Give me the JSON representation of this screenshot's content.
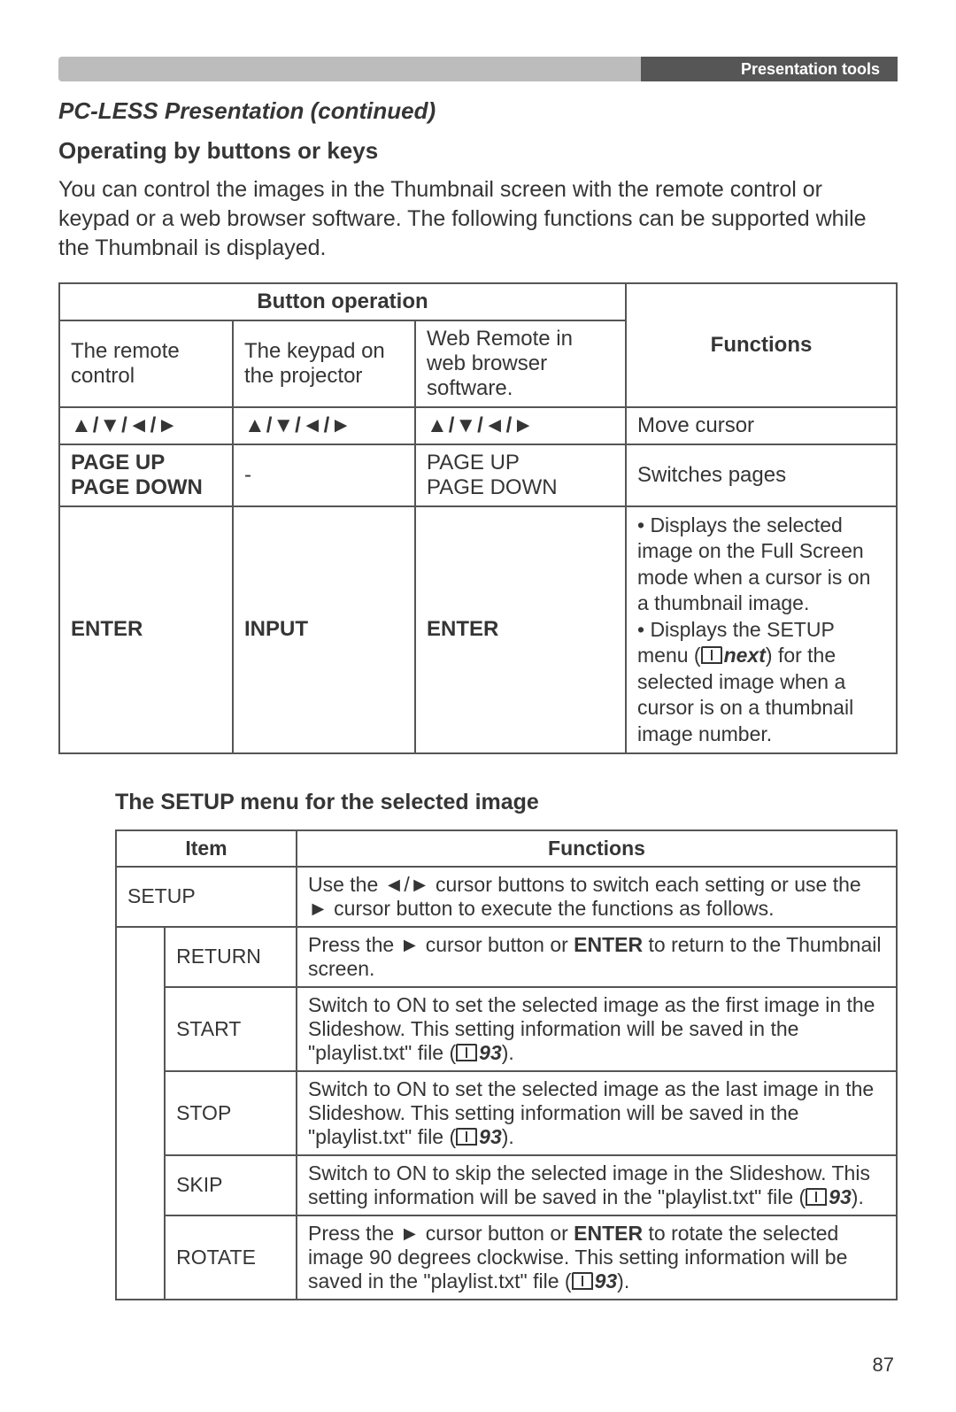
{
  "header": {
    "category": "Presentation tools"
  },
  "title": "PC-LESS Presentation (continued)",
  "operating_heading": "Operating by buttons or keys",
  "intro": "You can control the images in the Thumbnail screen with the remote control or keypad or a web browser software. The following functions can be supported while the Thumbnail is displayed.",
  "btn_table": {
    "header_button_operation": "Button operation",
    "header_functions": "Functions",
    "col_remote": "The remote control",
    "col_keypad": "The keypad on the projector",
    "col_web": "Web Remote in web browser software.",
    "row1": {
      "remote": "▲/▼/◄/►",
      "keypad": "▲/▼/◄/►",
      "web": "▲/▼/◄/►",
      "func": "Move cursor"
    },
    "row2": {
      "remote_l1": "PAGE UP",
      "remote_l2": "PAGE DOWN",
      "keypad": "-",
      "web_l1": "PAGE UP",
      "web_l2": "PAGE DOWN",
      "func": "Switches pages"
    },
    "row3": {
      "remote": "ENTER",
      "keypad": "INPUT",
      "web": "ENTER",
      "func_l1": "• Displays the selected image on the Full Screen mode when a cursor is on a thumbnail image.",
      "func_l2a": "• Displays the SETUP menu (",
      "func_ref": "next",
      "func_l2b": ") for the selected image when a cursor is on a thumbnail image number."
    }
  },
  "setup_heading": "The SETUP menu for the selected image",
  "setup_table": {
    "header_item": "Item",
    "header_functions": "Functions",
    "setup_label": "SETUP",
    "setup_func": "Use the ◄/► cursor buttons to switch each setting or use the ► cursor button to execute the functions as follows.",
    "return_label": "RETURN",
    "return_func_a": "Press the ► cursor button or ",
    "return_func_b": "ENTER",
    "return_func_c": " to return to the Thumbnail screen.",
    "start_label": "START",
    "start_func_a": "Switch to ON to set the selected image as the first image in the Slideshow. This setting information will be saved in the \"playlist.txt\" file (",
    "start_ref": "93",
    "start_func_b": ").",
    "stop_label": "STOP",
    "stop_func_a": "Switch to ON to set the selected image as the last image in the Slideshow. This setting information will be saved in the \"playlist.txt\" file (",
    "stop_ref": "93",
    "stop_func_b": ").",
    "skip_label": "SKIP",
    "skip_func_a": "Switch to ON to skip the selected image in the Slideshow. This setting information will be saved in the \"playlist.txt\" file (",
    "skip_ref": "93",
    "skip_func_b": ").",
    "rotate_label": "ROTATE",
    "rotate_func_a": "Press the ► cursor button or ",
    "rotate_func_b": "ENTER",
    "rotate_func_c": " to rotate the selected image 90 degrees clockwise. This setting information will be saved in the \"playlist.txt\" file (",
    "rotate_ref": "93",
    "rotate_func_d": ")."
  },
  "page_number": "87"
}
